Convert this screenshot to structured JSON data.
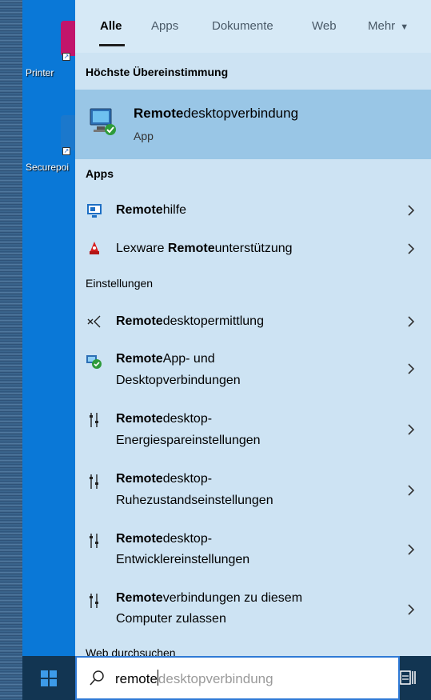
{
  "desktop": {
    "icons": [
      {
        "label": "Printer",
        "color": "#c2156b"
      },
      {
        "label": "Securepoi",
        "color": "#1b78cc"
      }
    ]
  },
  "search_panel": {
    "tabs": [
      {
        "label": "Alle",
        "active": true
      },
      {
        "label": "Apps",
        "active": false
      },
      {
        "label": "Dokumente",
        "active": false
      },
      {
        "label": "Web",
        "active": false
      },
      {
        "label": "Mehr",
        "active": false,
        "has_dropdown": true
      }
    ],
    "best_match": {
      "heading": "Höchste Übereinstimmung",
      "title_bold": "Remote",
      "title_rest": "desktopverbindung",
      "subtitle": "App",
      "icon": "remote-desktop-connection-icon"
    },
    "apps": {
      "heading": "Apps",
      "items": [
        {
          "prefix": "",
          "bold": "Remote",
          "rest": "hilfe",
          "icon": "remote-assistance-icon"
        },
        {
          "prefix": "Lexware ",
          "bold": "Remote",
          "rest": "unterstützung",
          "icon": "lexware-icon"
        }
      ]
    },
    "settings": {
      "heading": "Einstellungen",
      "items": [
        {
          "bold": "Remote",
          "line1_rest": "desktopermittlung",
          "line2": "",
          "icon": "remote-desktop-discovery-icon"
        },
        {
          "bold": "Remote",
          "line1_rest": "App- und",
          "line2": "Desktopverbindungen",
          "icon": "remoteapp-connections-icon"
        },
        {
          "bold": "Remote",
          "line1_rest": "desktop-",
          "line2": "Energiespareinstellungen",
          "icon": "settings-sliders-icon"
        },
        {
          "bold": "Remote",
          "line1_rest": "desktop-",
          "line2": "Ruhezustandseinstellungen",
          "icon": "settings-sliders-icon"
        },
        {
          "bold": "Remote",
          "line1_rest": "desktop-",
          "line2": "Entwicklereinstellungen",
          "icon": "settings-sliders-icon"
        },
        {
          "bold": "Remote",
          "line1_rest": "verbindungen zu diesem",
          "line2": "Computer zulassen",
          "icon": "settings-sliders-icon"
        }
      ]
    },
    "web": {
      "heading": "Web durchsuchen"
    }
  },
  "taskbar": {
    "search": {
      "typed": "remote",
      "suggestion": "desktopverbindung"
    }
  },
  "colors": {
    "panel_bg": "#cde3f3",
    "selected_bg": "#99c6e6",
    "taskbar_bg": "#123552",
    "desktop_bg": "#0a78d7",
    "search_border": "#2f7ad6"
  }
}
